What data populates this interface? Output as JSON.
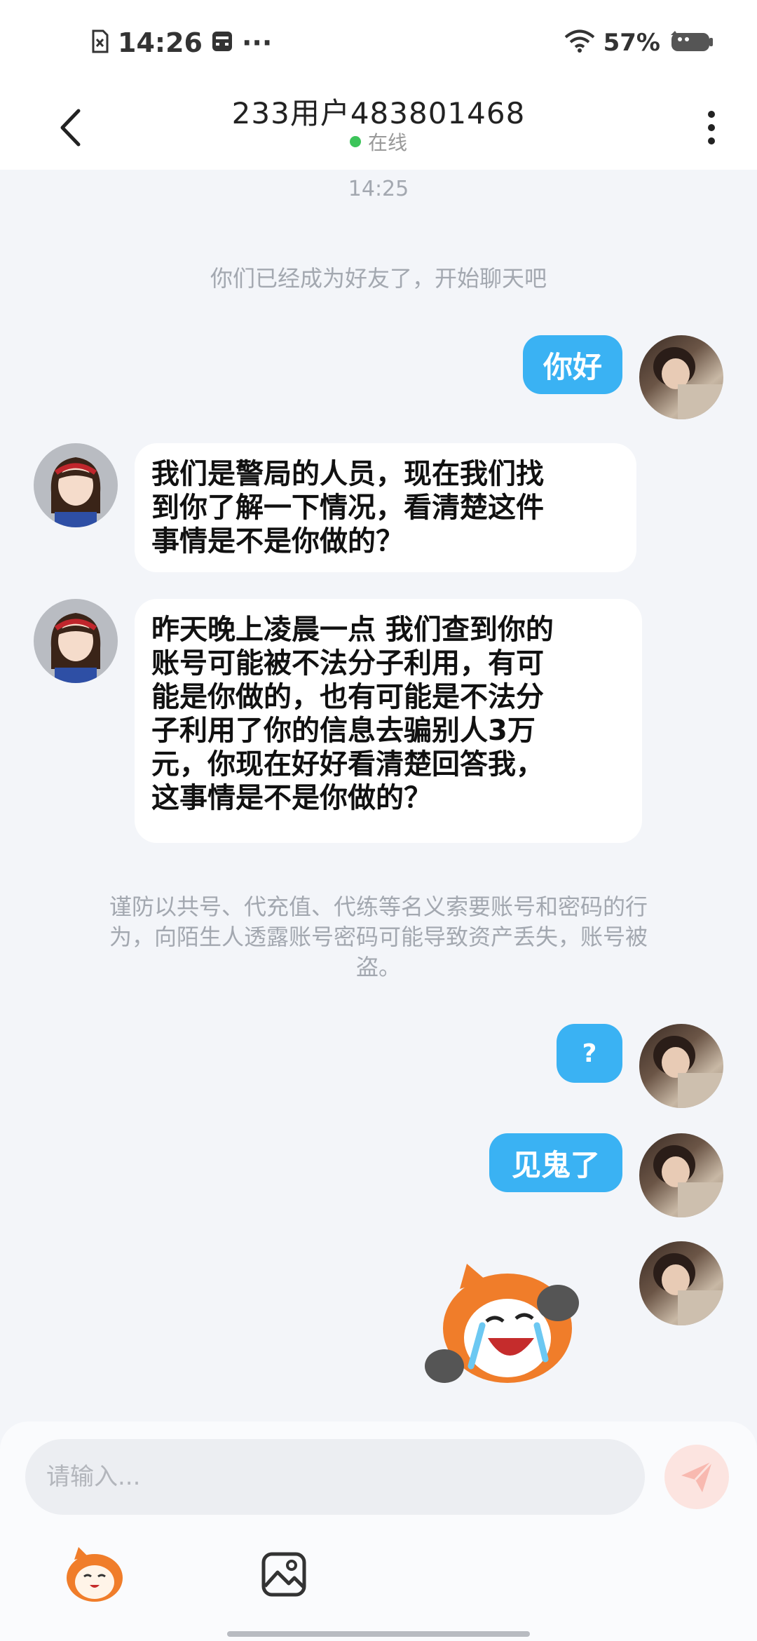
{
  "status_bar": {
    "time": "14:26",
    "more": "···",
    "battery": "57%"
  },
  "header": {
    "title": "233用户483801468",
    "status": "在线"
  },
  "chat": {
    "timestamp": "14:25",
    "system_message": "你们已经成为好友了，开始聊天吧",
    "messages": [
      {
        "from": "me",
        "text": "你好"
      },
      {
        "from": "other",
        "lines": [
          "我们是警局的人员，现在我们找",
          "到你了解一下情况，看清楚这件",
          "事情是不是你做的？"
        ]
      },
      {
        "from": "other",
        "lines": [
          "昨天晚上凌晨一点 我们查到你的",
          "账号可能被不法分子利用，有可",
          "能是你做的，也有可能是不法分",
          "子利用了你的信息去骗别人3万",
          "元，你现在好好看清楚回答我，",
          "这事情是不是你做的？"
        ]
      },
      {
        "from": "me",
        "text": "?"
      },
      {
        "from": "me",
        "text": "见鬼了"
      },
      {
        "from": "me",
        "sticker": "crying-mascot-sticker"
      }
    ],
    "notice_lines": [
      "谨防以共号、代充值、代练等名义索要账号和密码的行",
      "为，向陌生人透露账号密码可能导致资产丢失，账号被",
      "盗。"
    ]
  },
  "input": {
    "placeholder": "请输入..."
  },
  "colors": {
    "accent": "#3ab2f3",
    "online": "#3cc45a",
    "send_button": "#fce4e0",
    "background": "#f3f5f9"
  },
  "icons": [
    "back-arrow-icon",
    "more-vertical-icon",
    "wifi-icon",
    "battery-icon",
    "send-icon",
    "sticker-icon",
    "image-icon"
  ]
}
